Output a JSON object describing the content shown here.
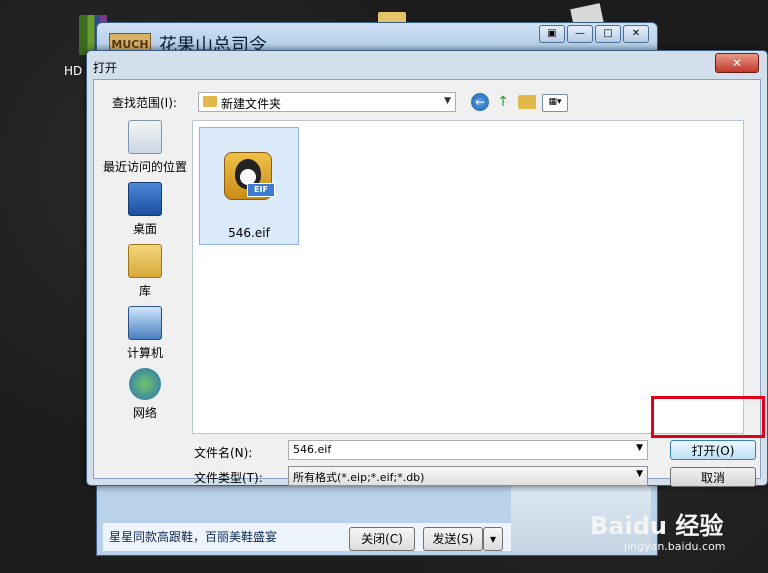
{
  "desktop": {
    "hd_label": "HD"
  },
  "back_window": {
    "title": "花果山总司令",
    "logo_text": "MUCH",
    "status_text": "星星同款高跟鞋，百丽美鞋盛宴",
    "close_button": "关闭(C)",
    "send_button": "发送(S)"
  },
  "dialog": {
    "title": "打开",
    "close_symbol": "✕",
    "look_in_label": "查找范围(I):",
    "look_in_value": "新建文件夹",
    "places": [
      {
        "label": "最近访问的位置",
        "icon": "recent-places-icon"
      },
      {
        "label": "桌面",
        "icon": "desktop-icon"
      },
      {
        "label": "库",
        "icon": "library-icon"
      },
      {
        "label": "计算机",
        "icon": "computer-icon"
      },
      {
        "label": "网络",
        "icon": "network-icon"
      }
    ],
    "files": [
      {
        "name": "546.eif",
        "badge": "EIF"
      }
    ],
    "file_name_label": "文件名(N):",
    "file_name_value": "546.eif",
    "file_type_label": "文件类型(T):",
    "file_type_value": "所有格式(*.eip;*.eif;*.db)",
    "open_button": "打开(O)",
    "cancel_button": "取消"
  },
  "watermark": {
    "text": "Baidu 经验",
    "sub": "jingyan.baidu.com"
  }
}
